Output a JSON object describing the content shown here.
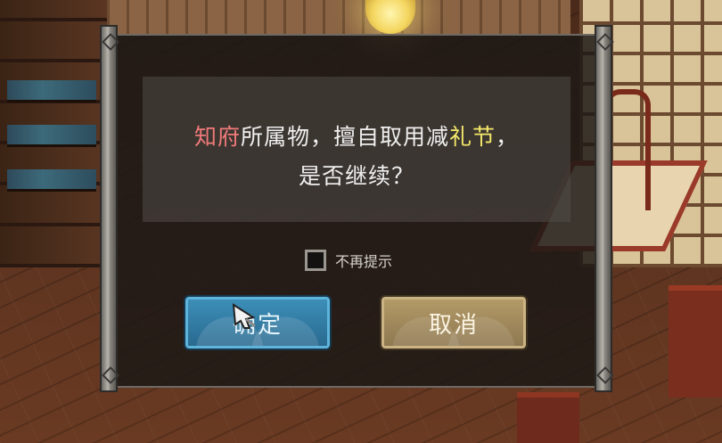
{
  "dialog": {
    "message_line1": {
      "part1": "知府",
      "part2": "所属物，擅自取用减",
      "part3": "礼节",
      "part4": "，"
    },
    "message_line2": "是否继续？",
    "checkbox_label": "不再提示",
    "checkbox_checked": false,
    "confirm_label": "确定",
    "cancel_label": "取消"
  },
  "colors": {
    "highlight_red": "#f07a7a",
    "highlight_yellow": "#f4e96a",
    "confirm_button": "#2f7aa4",
    "cancel_button": "#a08a5c"
  },
  "icons": {
    "cursor": "brush-cursor-icon",
    "lantern": "lantern-icon"
  }
}
